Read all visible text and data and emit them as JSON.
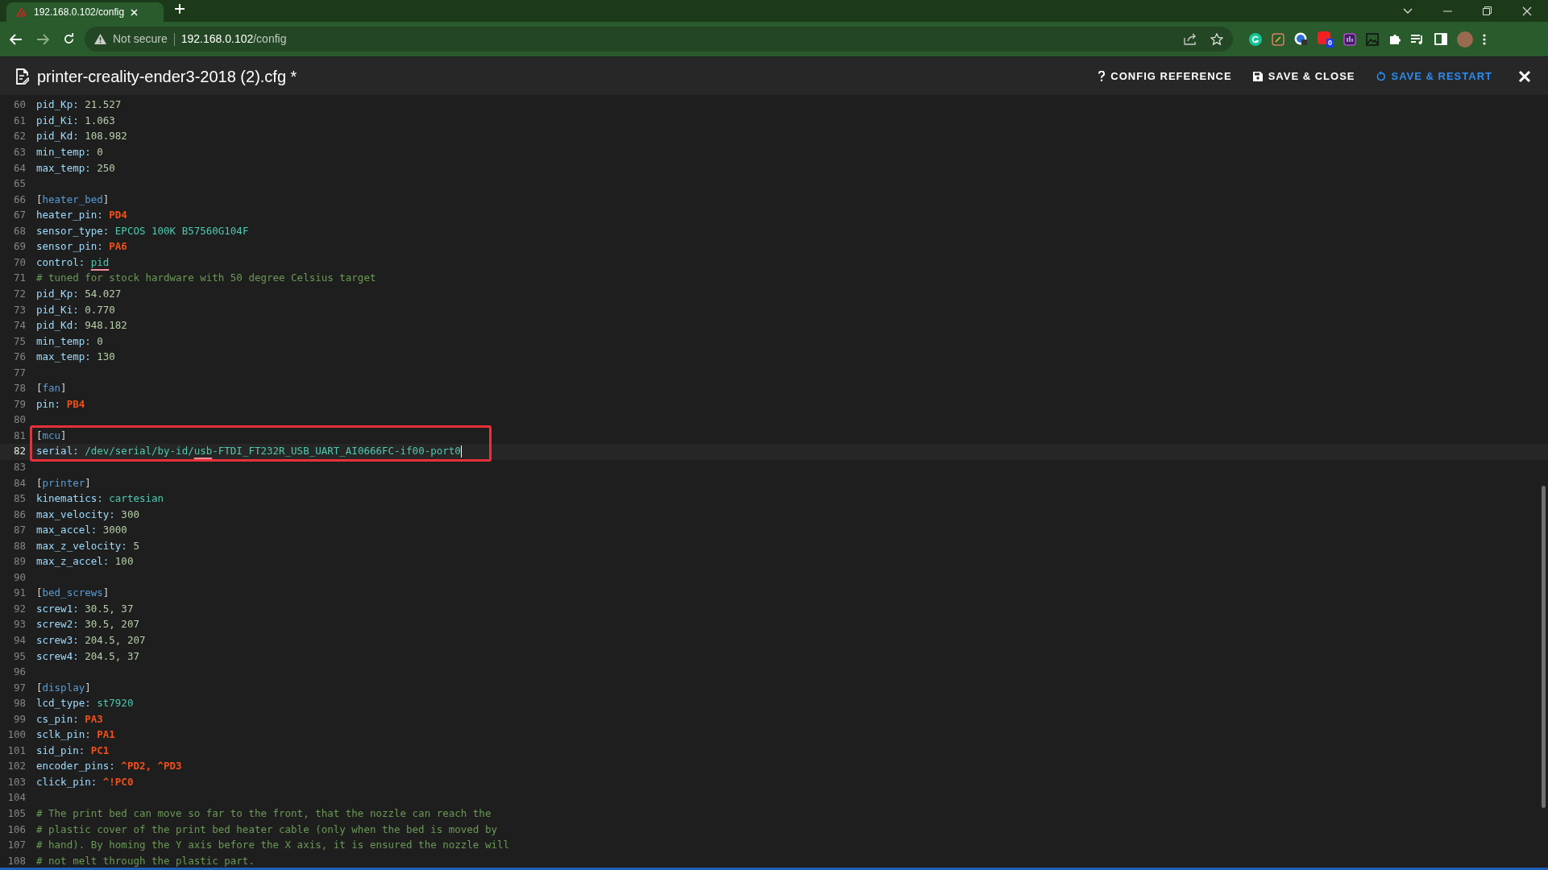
{
  "browser": {
    "tabs": [
      {
        "title": "192.168.0.102/config",
        "selected": true
      }
    ],
    "security": "Not secure",
    "address_host": "192.168.0.102",
    "address_path": "/config",
    "extension_badge": "0"
  },
  "editor": {
    "title": "printer-creality-ender3-2018 (2).cfg *",
    "actions": [
      {
        "kind": "help",
        "label": "CONFIG REFERENCE",
        "accent": false
      },
      {
        "kind": "save",
        "label": "SAVE & CLOSE",
        "accent": false
      },
      {
        "kind": "restart",
        "label": "SAVE & RESTART",
        "accent": true
      }
    ],
    "lines": [
      {
        "kind": "pair",
        "number": "60",
        "key": "pid_Kp:",
        "value": [
          {
            "kind": "number",
            "text": "21.527",
            "flagged": false
          }
        ]
      },
      {
        "kind": "pair",
        "number": "61",
        "key": "pid_Ki:",
        "value": [
          {
            "kind": "number",
            "text": "1.063",
            "flagged": false
          }
        ]
      },
      {
        "kind": "pair",
        "number": "62",
        "key": "pid_Kd:",
        "value": [
          {
            "kind": "number",
            "text": "108.982",
            "flagged": false
          }
        ]
      },
      {
        "kind": "pair",
        "number": "63",
        "key": "min_temp:",
        "value": [
          {
            "kind": "number",
            "text": "0",
            "flagged": false
          }
        ]
      },
      {
        "kind": "pair",
        "number": "64",
        "key": "max_temp:",
        "value": [
          {
            "kind": "number",
            "text": "250",
            "flagged": false
          }
        ]
      },
      {
        "kind": "blank",
        "number": "65"
      },
      {
        "kind": "section",
        "number": "66",
        "name": "[heater_bed]"
      },
      {
        "kind": "pair",
        "number": "67",
        "key": "heater_pin:",
        "value": [
          {
            "kind": "pin",
            "text": "PD4",
            "flagged": false
          }
        ]
      },
      {
        "kind": "pair",
        "number": "68",
        "key": "sensor_type:",
        "value": [
          {
            "kind": "string",
            "text": "EPCOS 100K B57560G104F",
            "flagged": false
          }
        ]
      },
      {
        "kind": "pair",
        "number": "69",
        "key": "sensor_pin:",
        "value": [
          {
            "kind": "pin",
            "text": "PA6",
            "flagged": false
          }
        ]
      },
      {
        "kind": "pair",
        "number": "70",
        "key": "control:",
        "value": [
          {
            "kind": "string",
            "text": "pid",
            "flagged": true
          }
        ]
      },
      {
        "kind": "comment",
        "number": "71",
        "text": "# tuned for stock hardware with 50 degree Celsius target"
      },
      {
        "kind": "pair",
        "number": "72",
        "key": "pid_Kp:",
        "value": [
          {
            "kind": "number",
            "text": "54.027",
            "flagged": false
          }
        ]
      },
      {
        "kind": "pair",
        "number": "73",
        "key": "pid_Ki:",
        "value": [
          {
            "kind": "number",
            "text": "0.770",
            "flagged": false
          }
        ]
      },
      {
        "kind": "pair",
        "number": "74",
        "key": "pid_Kd:",
        "value": [
          {
            "kind": "number",
            "text": "948.182",
            "flagged": false
          }
        ]
      },
      {
        "kind": "pair",
        "number": "75",
        "key": "min_temp:",
        "value": [
          {
            "kind": "number",
            "text": "0",
            "flagged": false
          }
        ]
      },
      {
        "kind": "pair",
        "number": "76",
        "key": "max_temp:",
        "value": [
          {
            "kind": "number",
            "text": "130",
            "flagged": false
          }
        ]
      },
      {
        "kind": "blank",
        "number": "77"
      },
      {
        "kind": "section",
        "number": "78",
        "name": "[fan]"
      },
      {
        "kind": "pair",
        "number": "79",
        "key": "pin:",
        "value": [
          {
            "kind": "pin",
            "text": "PB4",
            "flagged": false
          }
        ]
      },
      {
        "kind": "blank",
        "number": "80"
      },
      {
        "kind": "group",
        "children": [
          {
            "kind": "section",
            "number": "81",
            "name": "[mcu]"
          },
          {
            "kind": "pair",
            "number": "82",
            "key": "serial:",
            "value": [
              {
                "kind": "string",
                "text": "/dev/serial/by-id/",
                "flagged": false
              },
              {
                "kind": "string",
                "text": "usb",
                "flagged": true
              },
              {
                "kind": "string",
                "text": "-FTDI_FT232R_USB_UART_AI0666FC-if00-port0",
                "flagged": false
              }
            ],
            "current": true
          }
        ]
      },
      {
        "kind": "blank",
        "number": "83"
      },
      {
        "kind": "section",
        "number": "84",
        "name": "[printer]"
      },
      {
        "kind": "pair",
        "number": "85",
        "key": "kinematics:",
        "value": [
          {
            "kind": "string",
            "text": "cartesian",
            "flagged": false
          }
        ]
      },
      {
        "kind": "pair",
        "number": "86",
        "key": "max_velocity:",
        "value": [
          {
            "kind": "number",
            "text": "300",
            "flagged": false
          }
        ]
      },
      {
        "kind": "pair",
        "number": "87",
        "key": "max_accel:",
        "value": [
          {
            "kind": "number",
            "text": "3000",
            "flagged": false
          }
        ]
      },
      {
        "kind": "pair",
        "number": "88",
        "key": "max_z_velocity:",
        "value": [
          {
            "kind": "number",
            "text": "5",
            "flagged": false
          }
        ]
      },
      {
        "kind": "pair",
        "number": "89",
        "key": "max_z_accel:",
        "value": [
          {
            "kind": "number",
            "text": "100",
            "flagged": false
          }
        ]
      },
      {
        "kind": "blank",
        "number": "90"
      },
      {
        "kind": "section",
        "number": "91",
        "name": "[bed_screws]"
      },
      {
        "kind": "pair",
        "number": "92",
        "key": "screw1:",
        "value": [
          {
            "kind": "number",
            "text": "30.5, 37",
            "flagged": false
          }
        ]
      },
      {
        "kind": "pair",
        "number": "93",
        "key": "screw2:",
        "value": [
          {
            "kind": "number",
            "text": "30.5, 207",
            "flagged": false
          }
        ]
      },
      {
        "kind": "pair",
        "number": "94",
        "key": "screw3:",
        "value": [
          {
            "kind": "number",
            "text": "204.5, 207",
            "flagged": false
          }
        ]
      },
      {
        "kind": "pair",
        "number": "95",
        "key": "screw4:",
        "value": [
          {
            "kind": "number",
            "text": "204.5, 37",
            "flagged": false
          }
        ]
      },
      {
        "kind": "blank",
        "number": "96"
      },
      {
        "kind": "section",
        "number": "97",
        "name": "[display]"
      },
      {
        "kind": "pair",
        "number": "98",
        "key": "lcd_type:",
        "value": [
          {
            "kind": "string",
            "text": "st7920",
            "flagged": false
          }
        ]
      },
      {
        "kind": "pair",
        "number": "99",
        "key": "cs_pin:",
        "value": [
          {
            "kind": "pin",
            "text": "PA3",
            "flagged": false
          }
        ]
      },
      {
        "kind": "pair",
        "number": "100",
        "key": "sclk_pin:",
        "value": [
          {
            "kind": "pin",
            "text": "PA1",
            "flagged": false
          }
        ]
      },
      {
        "kind": "pair",
        "number": "101",
        "key": "sid_pin:",
        "value": [
          {
            "kind": "pin",
            "text": "PC1",
            "flagged": false
          }
        ]
      },
      {
        "kind": "pair",
        "number": "102",
        "key": "encoder_pins:",
        "value": [
          {
            "kind": "pin",
            "text": "^PD2, ^PD3",
            "flagged": false
          }
        ]
      },
      {
        "kind": "pair",
        "number": "103",
        "key": "click_pin:",
        "value": [
          {
            "kind": "pin",
            "text": "^!PC0",
            "flagged": false
          }
        ]
      },
      {
        "kind": "blank",
        "number": "104"
      },
      {
        "kind": "comment",
        "number": "105",
        "text": "# The print bed can move so far to the front, that the nozzle can reach the"
      },
      {
        "kind": "comment",
        "number": "106",
        "text": "# plastic cover of the print bed heater cable (only when the bed is moved by"
      },
      {
        "kind": "comment",
        "number": "107",
        "text": "# hand). By homing the Y axis before the X axis, it is ensured the nozzle will"
      },
      {
        "kind": "comment",
        "number": "108",
        "text": "# not melt through the plastic part."
      }
    ]
  }
}
